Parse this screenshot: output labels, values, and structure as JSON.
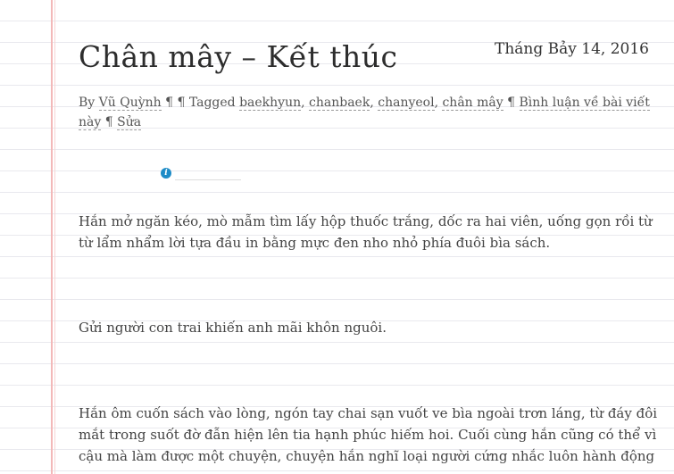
{
  "post": {
    "date": "Tháng Bảy 14, 2016",
    "title": "Chân mây – Kết thúc",
    "meta": {
      "by": "By",
      "author": "Vũ Quỳnh",
      "sep1": "¶ ¶ Tagged",
      "tags": [
        "baekhyun",
        "chanbaek",
        "chanyeol",
        "chân mây"
      ],
      "sep2": "¶",
      "comment_link": "Bình luận về bài viết này",
      "sep3": "¶",
      "edit_link": "Sửa"
    },
    "paragraphs": [
      "Hắn mở ngăn kéo, mò mẫm tìm lấy hộp thuốc trắng, dốc ra hai viên, uống gọn rồi từ từ lẩm nhẩm lời tựa đầu in bằng mực đen nho nhỏ phía đuôi bìa sách.",
      "Gửi người con trai khiến anh mãi khôn nguôi.",
      "Hắn ôm cuốn sách vào lòng, ngón tay chai sạn vuốt ve bìa ngoài trơn láng, từ đáy đôi mắt trong suốt đờ đẫn hiện lên tia hạnh phúc hiếm hoi. Cuối cùng hắn cũng có thể vì cậu mà làm được một chuyện, chuyện hắn nghĩ loại người cứng nhắc luôn hành động"
    ]
  },
  "icons": {
    "info": "info-icon"
  },
  "colors": {
    "margin": "#f3b9b9",
    "info": "#1e8cc7"
  }
}
